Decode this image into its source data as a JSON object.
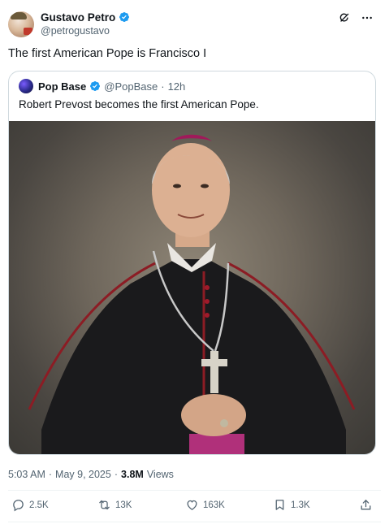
{
  "author": {
    "display_name": "Gustavo Petro",
    "handle": "@petrogustavo"
  },
  "tweet": {
    "text": "The first American Pope is Francisco I",
    "time": "5:03 AM",
    "separator": "·",
    "date": "May 9, 2025",
    "views_count": "3.8M",
    "views_label": "Views"
  },
  "quoted": {
    "display_name": "Pop Base",
    "handle": "@PopBase",
    "dot": "·",
    "age": "12h",
    "text": "Robert Prevost becomes the first American Pope."
  },
  "actions": {
    "replies": "2.5K",
    "reposts": "13K",
    "likes": "163K",
    "bookmarks": "1.3K"
  },
  "colors": {
    "verified": "#1d9bf0",
    "secondary_text": "#536471",
    "border": "#cfd9de"
  },
  "icons": [
    "grok-icon",
    "more-icon",
    "verified-badge-icon",
    "reply-icon",
    "repost-icon",
    "like-icon",
    "bookmark-icon",
    "share-icon"
  ]
}
